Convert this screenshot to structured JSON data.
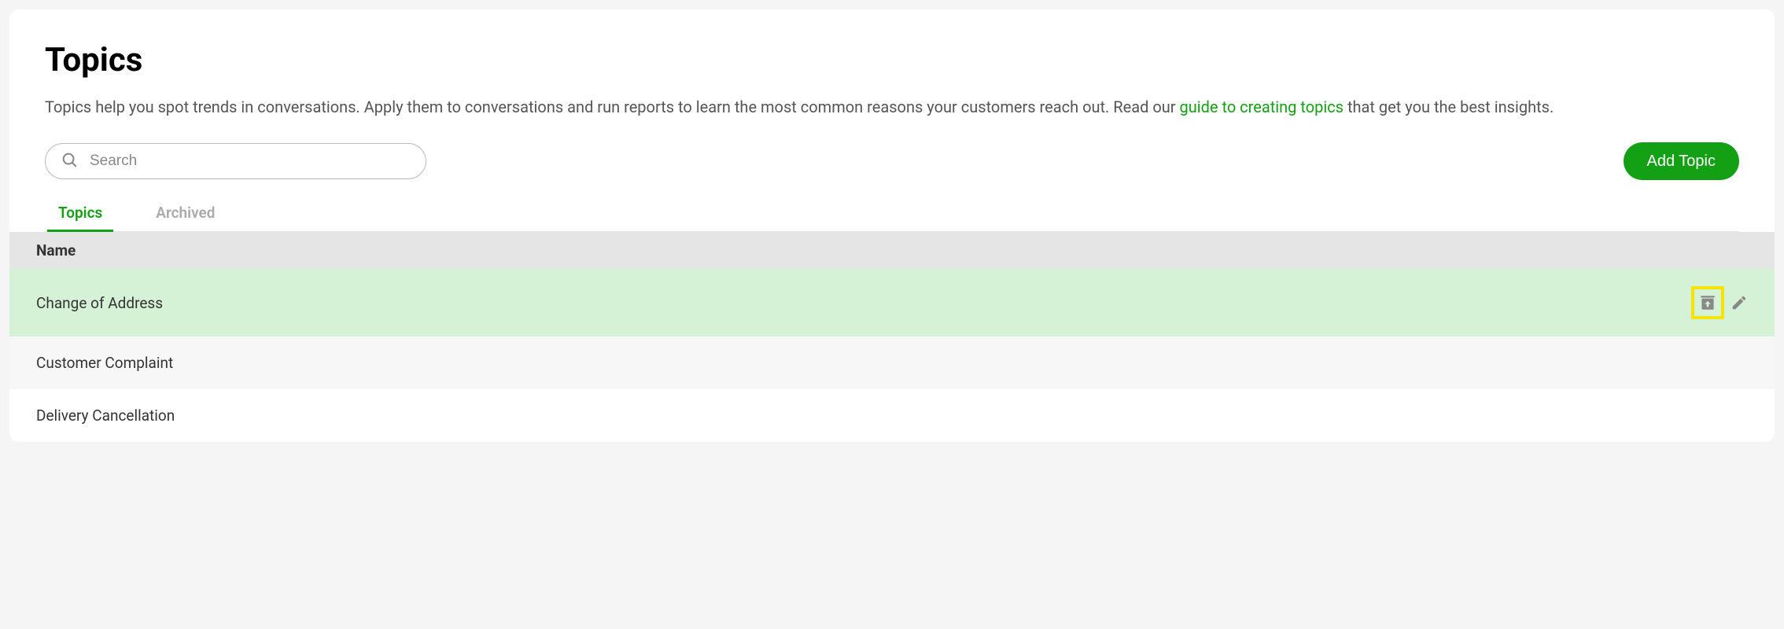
{
  "header": {
    "title": "Topics",
    "description_before": "Topics help you spot trends in conversations. Apply them to conversations and run reports to learn the most common reasons your customers reach out. Read our ",
    "link_text": "guide to creating topics",
    "description_after": " that get you the best insights."
  },
  "toolbar": {
    "search_placeholder": "Search",
    "add_button_label": "Add Topic"
  },
  "tabs": {
    "topics": "Topics",
    "archived": "Archived"
  },
  "table": {
    "column_name": "Name",
    "rows": [
      {
        "name": "Change of Address"
      },
      {
        "name": "Customer Complaint"
      },
      {
        "name": "Delivery Cancellation"
      }
    ]
  }
}
